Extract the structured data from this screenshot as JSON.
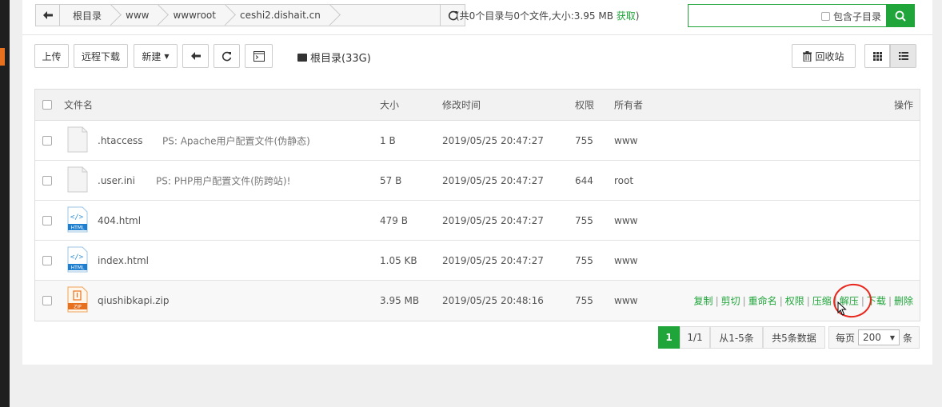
{
  "breadcrumbs": [
    "根目录",
    "www",
    "wwwroot",
    "ceshi2.dishait.cn"
  ],
  "stats": {
    "text": "(共0个目录与0个文件,大小:3.95 MB",
    "fetch": "获取",
    "close": ")"
  },
  "search": {
    "placeholder": "",
    "subdir_label": "包含子目录"
  },
  "toolbar": {
    "upload": "上传",
    "remote_download": "远程下载",
    "new": "新建",
    "disk_label": "根目录(33G)",
    "recycle_bin": "回收站"
  },
  "table": {
    "headers": {
      "name": "文件名",
      "size": "大小",
      "mtime": "修改时间",
      "perm": "权限",
      "owner": "所有者",
      "ops": "操作"
    },
    "rows": [
      {
        "name": ".htaccess",
        "note": "PS: Apache用户配置文件(伪静态)",
        "size": "1 B",
        "mtime": "2019/05/25 20:47:27",
        "perm": "755",
        "owner": "www",
        "icon": "file-icon"
      },
      {
        "name": ".user.ini",
        "note": "PS: PHP用户配置文件(防跨站)!",
        "size": "57 B",
        "mtime": "2019/05/25 20:47:27",
        "perm": "644",
        "owner": "root",
        "icon": "file-icon"
      },
      {
        "name": "404.html",
        "note": "",
        "size": "479 B",
        "mtime": "2019/05/25 20:47:27",
        "perm": "755",
        "owner": "www",
        "icon": "html-file-icon"
      },
      {
        "name": "index.html",
        "note": "",
        "size": "1.05 KB",
        "mtime": "2019/05/25 20:47:27",
        "perm": "755",
        "owner": "www",
        "icon": "html-file-icon"
      },
      {
        "name": "qiushibkapi.zip",
        "note": "",
        "size": "3.95 MB",
        "mtime": "2019/05/25 20:48:16",
        "perm": "755",
        "owner": "www",
        "icon": "zip-file-icon"
      }
    ],
    "row_ops": [
      "复制",
      "剪切",
      "重命名",
      "权限",
      "压缩",
      "解压",
      "下载",
      "删除"
    ],
    "icon_badges": {
      "html": "HTML",
      "zip": "ZIP",
      "code": "</>"
    }
  },
  "pagination": {
    "current": "1",
    "pages": "1/1",
    "range": "从1-5条",
    "total": "共5条数据",
    "per_page_label": "每页",
    "per_page": "200",
    "unit": "条"
  },
  "colors": {
    "accent": "#20a53a",
    "highlight_circle": "#e8281e"
  }
}
